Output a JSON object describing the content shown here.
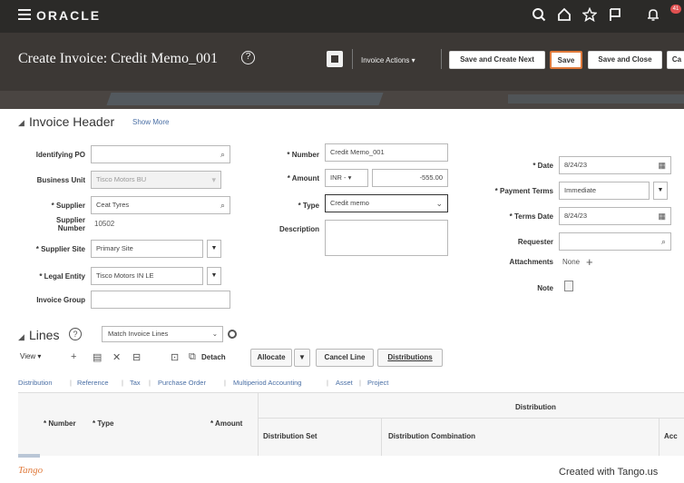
{
  "topbar": {
    "brand": "ORACLE",
    "notif_count": "41"
  },
  "header": {
    "title": "Create Invoice: Credit Memo_001",
    "help_glyph": "?",
    "invoice_actions": "Invoice Actions ▾",
    "save_create_next": "Save and Create Next",
    "save": "Save",
    "save_close": "Save and Close",
    "cancel": "Ca"
  },
  "invoice_header": {
    "title": "Invoice Header",
    "show_more": "Show More",
    "identifying_po_label": "Identifying PO",
    "identifying_po_value": "",
    "business_unit_label": "Business Unit",
    "business_unit_value": "Tisco Motors BU",
    "supplier_label": "Supplier",
    "supplier_value": "Ceat Tyres",
    "supplier_number_label": "Supplier Number",
    "supplier_number_value": "10502",
    "supplier_site_label": "Supplier Site",
    "supplier_site_value": "Primary Site",
    "legal_entity_label": "Legal Entity",
    "legal_entity_value": "Tisco Motors IN LE",
    "invoice_group_label": "Invoice Group",
    "invoice_group_value": "",
    "number_label": "Number",
    "number_value": "Credit Memo_001",
    "amount_label": "Amount",
    "currency_value": "INR - ▾",
    "amount_value": "-555.00",
    "type_label": "Type",
    "type_value": "Credit memo",
    "description_label": "Description",
    "date_label": "Date",
    "date_value": "8/24/23",
    "payment_terms_label": "Payment Terms",
    "payment_terms_value": "Immediate",
    "terms_date_label": "Terms Date",
    "terms_date_value": "8/24/23",
    "requester_label": "Requester",
    "requester_value": "",
    "attachments_label": "Attachments",
    "attachments_value": "None",
    "note_label": "Note"
  },
  "lines": {
    "title": "Lines",
    "match_select": "Match Invoice Lines",
    "view_menu": "View ▾",
    "detach": "Detach",
    "allocate": "Allocate",
    "cancel_line": "Cancel Line",
    "distributions": "Distributions",
    "tabs": [
      "Distribution",
      "Reference",
      "Tax",
      "Purchase Order",
      "Multiperiod Accounting",
      "Asset",
      "Project"
    ],
    "table": {
      "group_header": "Distribution",
      "col_number": "Number",
      "col_type": "Type",
      "col_amount": "Amount",
      "col_dist_set": "Distribution Set",
      "col_dist_combo": "Distribution Combination",
      "col_acc": "Acc"
    }
  },
  "footer": {
    "logo": "Tango",
    "credit": "Created with Tango.us"
  }
}
